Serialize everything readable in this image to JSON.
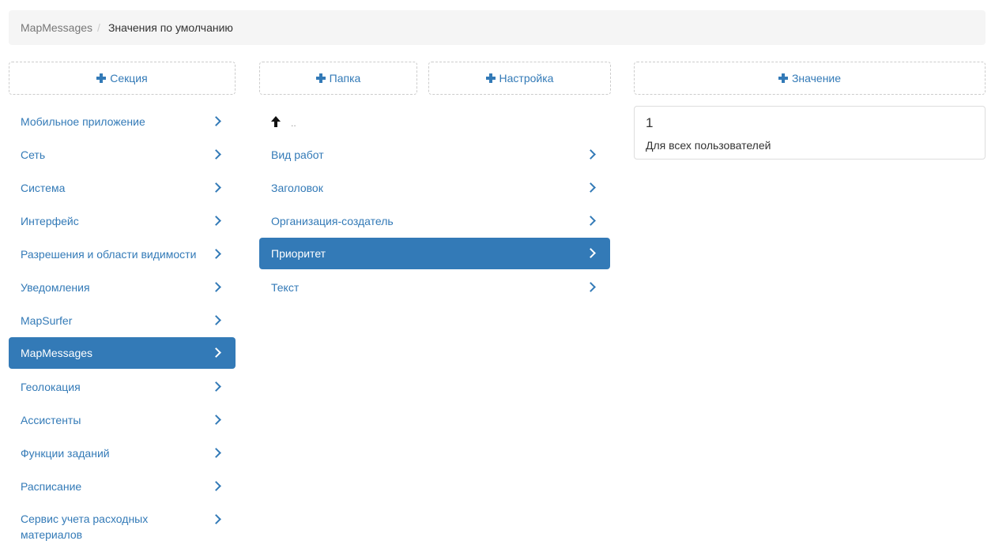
{
  "breadcrumb": {
    "root": "MapMessages",
    "separator": "/",
    "current": "Значения по умолчанию"
  },
  "sections": {
    "add_label": "Секция",
    "items": [
      {
        "label": "Мобильное приложение",
        "active": false
      },
      {
        "label": "Сеть",
        "active": false
      },
      {
        "label": "Система",
        "active": false
      },
      {
        "label": "Интерфейс",
        "active": false
      },
      {
        "label": "Разрешения и области видимости",
        "active": false
      },
      {
        "label": "Уведомления",
        "active": false
      },
      {
        "label": "MapSurfer",
        "active": false
      },
      {
        "label": "MapMessages",
        "active": true
      },
      {
        "label": "Геолокация",
        "active": false
      },
      {
        "label": "Ассистенты",
        "active": false
      },
      {
        "label": "Функции заданий",
        "active": false
      },
      {
        "label": "Расписание",
        "active": false
      },
      {
        "label": "Сервис учета расходных материалов",
        "active": false
      }
    ]
  },
  "settings": {
    "add_folder_label": "Папка",
    "add_setting_label": "Настройка",
    "up_label": "..",
    "items": [
      {
        "label": "Вид работ",
        "active": false
      },
      {
        "label": "Заголовок",
        "active": false
      },
      {
        "label": "Организация-создатель",
        "active": false
      },
      {
        "label": "Приоритет",
        "active": true
      },
      {
        "label": "Текст",
        "active": false
      }
    ]
  },
  "values": {
    "add_label": "Значение",
    "items": [
      {
        "value": "1",
        "scope": "Для всех пользователей"
      }
    ]
  },
  "colors": {
    "accent": "#337ab7",
    "active_text": "#ffffff",
    "breadcrumb_bg": "#f5f5f5"
  },
  "icons": {
    "plus": "plus-icon",
    "chevron": "chevron-right-icon",
    "up": "arrow-up-icon"
  }
}
